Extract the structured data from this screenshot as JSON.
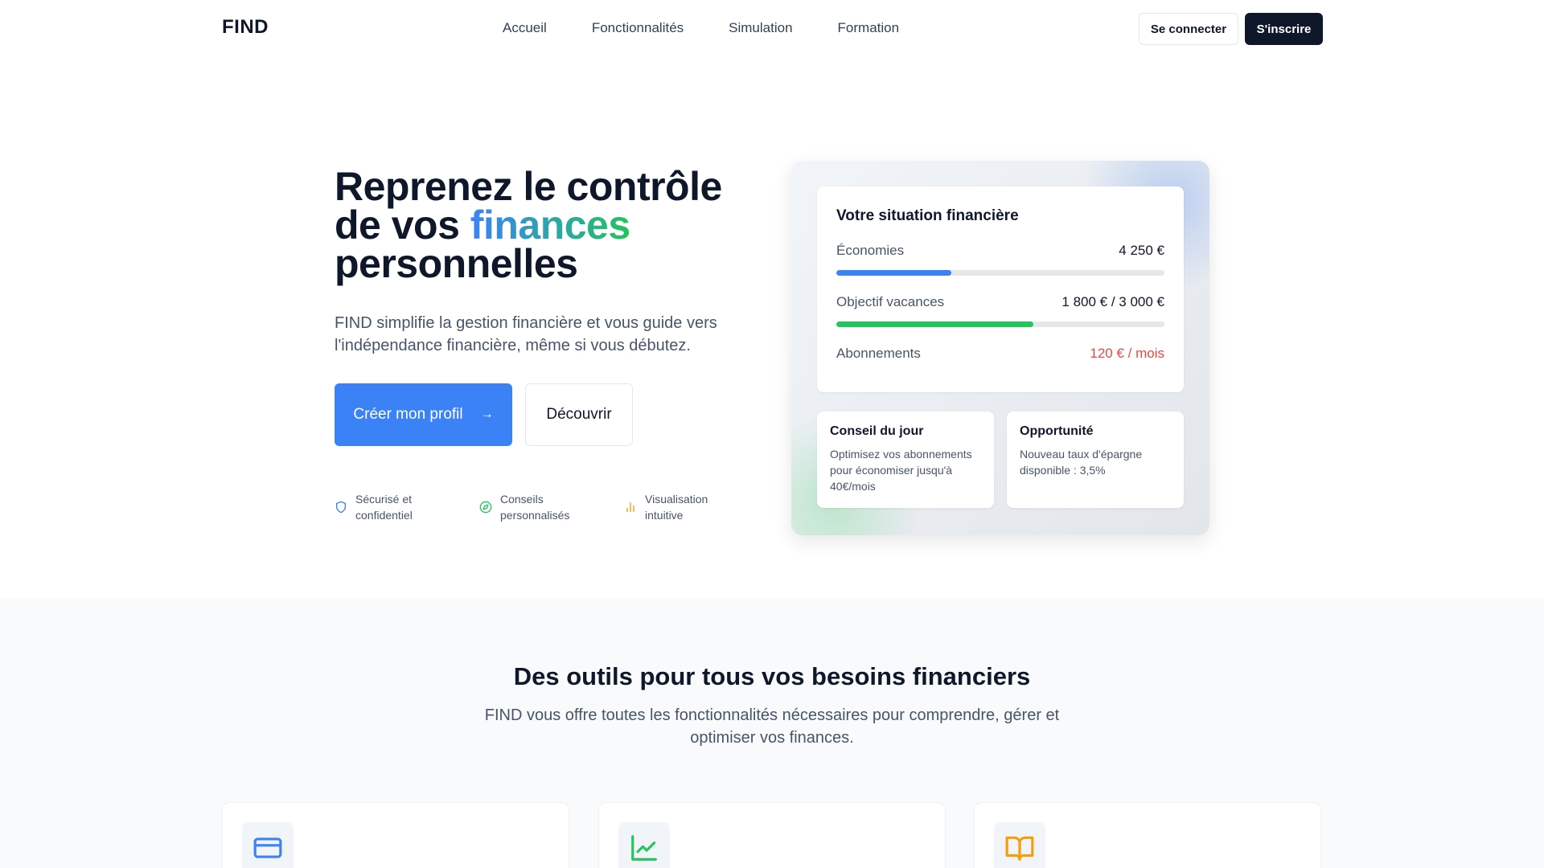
{
  "nav": {
    "logo": "FIND",
    "links": [
      "Accueil",
      "Fonctionnalités",
      "Simulation",
      "Formation"
    ],
    "login": "Se connecter",
    "signup": "S'inscrire"
  },
  "hero": {
    "title_line1": "Reprenez le contrôle",
    "title_line2_prefix": "de vos ",
    "title_highlight": "finances",
    "title_line3": "personnelles",
    "subtitle": "FIND simplifie la gestion financière et vous guide vers l'indépendance financière, même si vous débutez.",
    "cta_primary": "Créer mon profil",
    "cta_secondary": "Découvrir",
    "features": [
      {
        "label": "Sécurisé et confidentiel",
        "icon": "shield-icon",
        "color": "#3b82f6"
      },
      {
        "label": "Conseils personnalisés",
        "icon": "compass-icon",
        "color": "#22c55e"
      },
      {
        "label": "Visualisation intuitive",
        "icon": "bar-chart-icon",
        "color": "#f59e0b"
      }
    ]
  },
  "dashboard": {
    "title": "Votre situation financière",
    "savings": {
      "label": "Économies",
      "value": "4 250 €",
      "progress": 0.35,
      "color": "#3b82f6"
    },
    "vacation": {
      "label": "Objectif vacances",
      "value": "1 800 € / 3 000 €",
      "progress": 0.6,
      "color": "#22c55e"
    },
    "subscriptions": {
      "label": "Abonnements",
      "value": "120 € / mois",
      "color": "#ef4444"
    },
    "tip": {
      "title": "Conseil du jour",
      "text": "Optimisez vos abonnements pour économiser jusqu'à 40€/mois"
    },
    "opportunity": {
      "title": "Opportunité",
      "text": "Nouveau taux d'épargne disponible : 3,5%"
    }
  },
  "tools": {
    "title": "Des outils pour tous vos besoins financiers",
    "subtitle": "FIND vous offre toutes les fonctionnalités nécessaires pour comprendre, gérer et optimiser vos finances.",
    "cards": [
      {
        "icon": "credit-card-icon",
        "color": "#3b82f6"
      },
      {
        "icon": "line-chart-icon",
        "color": "#22c55e"
      },
      {
        "icon": "book-open-icon",
        "color": "#f59e0b"
      }
    ]
  }
}
